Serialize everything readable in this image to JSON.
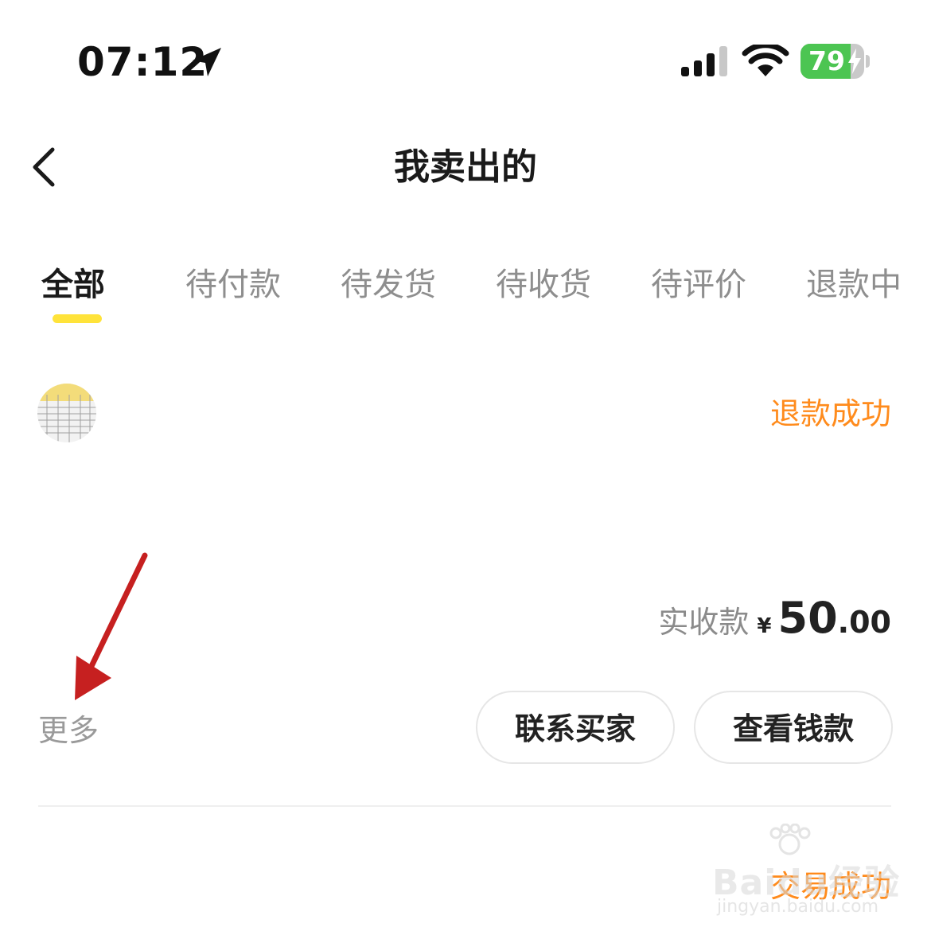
{
  "status_bar": {
    "time": "07:12",
    "battery_level": "79",
    "battery_fraction": 0.79,
    "icons": [
      "location-arrow-icon",
      "cellular-signal-icon",
      "wifi-icon",
      "battery-charging-icon"
    ]
  },
  "nav": {
    "title": "我卖出的",
    "back_icon": "chevron-left-icon"
  },
  "tabs": [
    {
      "label": "全部",
      "active": true
    },
    {
      "label": "待付款",
      "active": false
    },
    {
      "label": "待发货",
      "active": false
    },
    {
      "label": "待收货",
      "active": false
    },
    {
      "label": "待评价",
      "active": false
    },
    {
      "label": "退款中",
      "active": false
    }
  ],
  "orders": [
    {
      "status": "退款成功",
      "amount_label": "实收款",
      "currency": "¥",
      "amount_int": "50",
      "amount_dec": ".00",
      "more_label": "更多",
      "actions": [
        "联系买家",
        "查看钱款"
      ]
    },
    {
      "status": "交易成功"
    }
  ],
  "watermark": {
    "text": "Baidu经验",
    "sub": "jingyan.baidu.com"
  },
  "colors": {
    "accent_orange": "#ff8b1c",
    "tab_indicator": "#ffe33a",
    "annotation_arrow": "#c62020",
    "battery_green": "#4cc552"
  }
}
